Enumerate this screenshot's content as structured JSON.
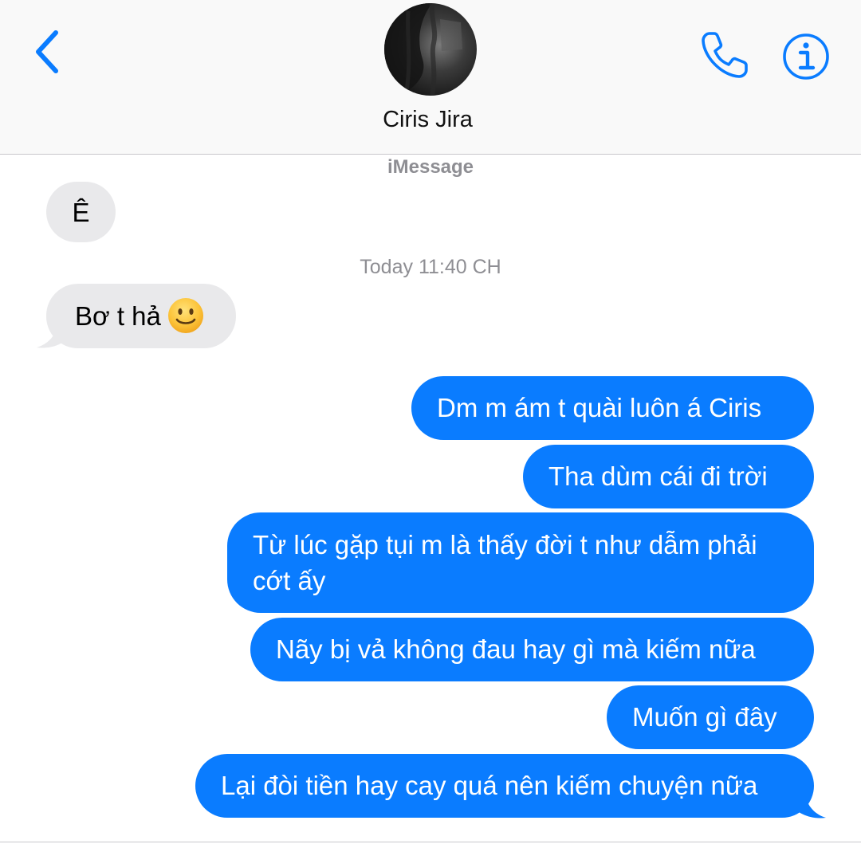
{
  "header": {
    "contact_name": "Ciris Jira",
    "back_icon": "chevron-left-icon",
    "call_icon": "phone-icon",
    "info_icon": "info-icon"
  },
  "conversation": {
    "service": "iMessage",
    "timestamp": "Today 11:40 CH",
    "messages": [
      {
        "direction": "incoming",
        "text": "Ê"
      },
      {
        "direction": "incoming",
        "text": "Bơ t hả",
        "emoji": "slightly-smiling-face"
      },
      {
        "direction": "outgoing",
        "text": "Dm m ám t quài luôn á Ciris"
      },
      {
        "direction": "outgoing",
        "text": "Tha dùm cái đi trời"
      },
      {
        "direction": "outgoing",
        "text": "Từ lúc gặp tụi m là thấy đời t như dẫm phải cớt ấy"
      },
      {
        "direction": "outgoing",
        "text": "Nãy bị vả không đau hay gì mà kiếm nữa"
      },
      {
        "direction": "outgoing",
        "text": "Muốn gì đây"
      },
      {
        "direction": "outgoing",
        "text": "Lại đòi tiền hay cay quá nên kiếm chuyện nữa"
      }
    ]
  },
  "colors": {
    "accent": "#0a7cff",
    "incoming_bubble": "#e9e9eb",
    "meta_text": "#8e8e93"
  }
}
